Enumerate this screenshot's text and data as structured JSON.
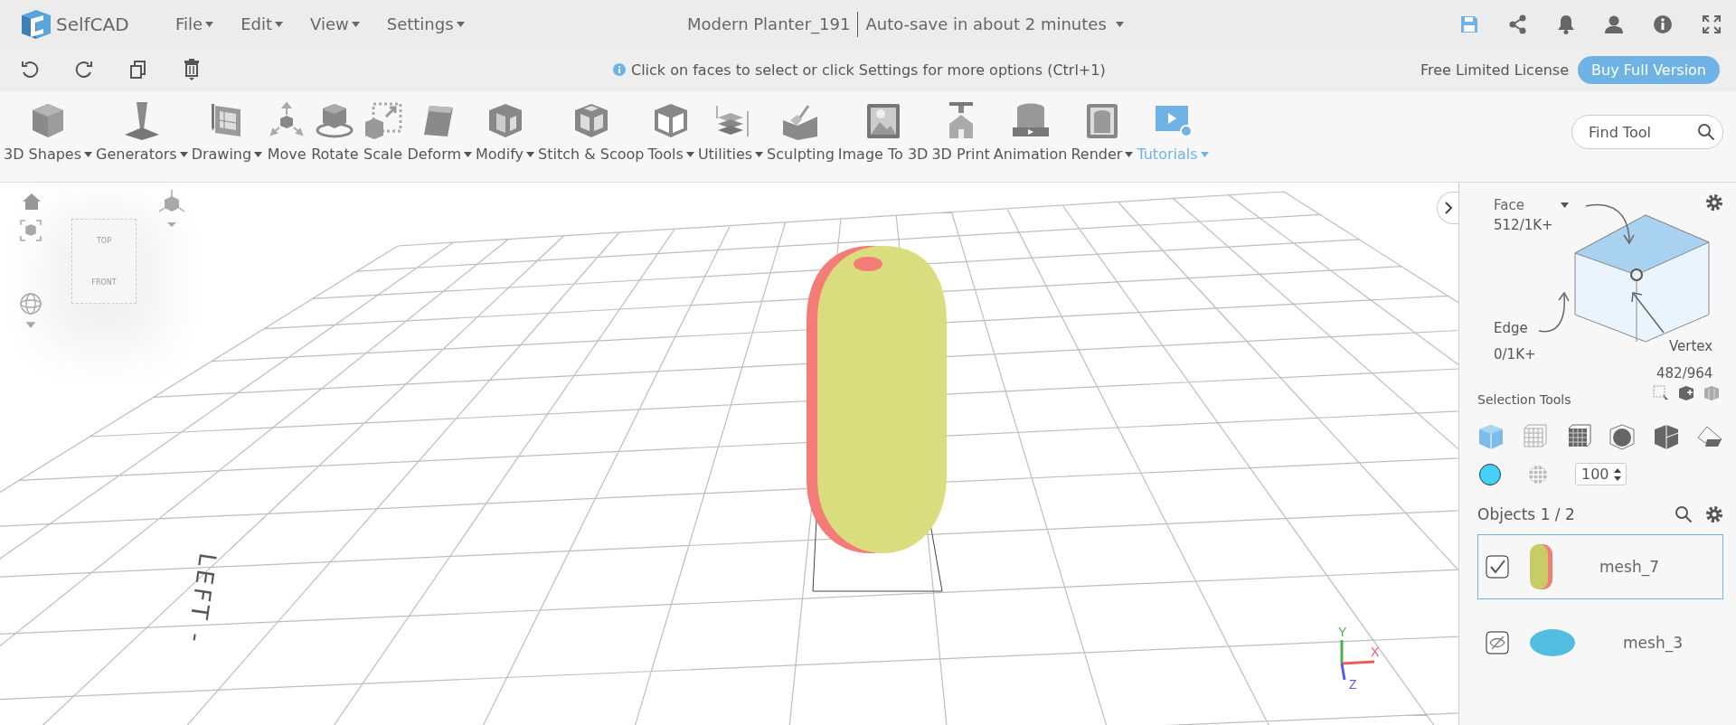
{
  "app": {
    "logo_text": "SelfCAD"
  },
  "menu": [
    "File",
    "Edit",
    "View",
    "Settings"
  ],
  "document": {
    "title": "Modern Planter_191",
    "autosave": "Auto-save in about 2 minutes"
  },
  "hint": "Click on faces to select or click Settings for more options (Ctrl+1)",
  "license": "Free Limited License",
  "buy_button": "Buy Full Version",
  "tools": [
    {
      "label": "3D Shapes",
      "dropdown": true,
      "highlighted": false
    },
    {
      "label": "Generators",
      "dropdown": true,
      "highlighted": false
    },
    {
      "label": "Drawing",
      "dropdown": true,
      "highlighted": false
    },
    {
      "label": "Move",
      "dropdown": false,
      "highlighted": false
    },
    {
      "label": "Rotate",
      "dropdown": false,
      "highlighted": false
    },
    {
      "label": "Scale",
      "dropdown": false,
      "highlighted": false
    },
    {
      "label": "Deform",
      "dropdown": true,
      "highlighted": false
    },
    {
      "label": "Modify",
      "dropdown": true,
      "highlighted": false
    },
    {
      "label": "Stitch & Scoop",
      "dropdown": false,
      "highlighted": false
    },
    {
      "label": "Tools",
      "dropdown": true,
      "highlighted": false
    },
    {
      "label": "Utilities",
      "dropdown": true,
      "highlighted": false
    },
    {
      "label": "Sculpting",
      "dropdown": false,
      "highlighted": false
    },
    {
      "label": "Image To 3D",
      "dropdown": false,
      "highlighted": false
    },
    {
      "label": "3D Print",
      "dropdown": false,
      "highlighted": false
    },
    {
      "label": "Animation",
      "dropdown": false,
      "highlighted": false
    },
    {
      "label": "Render",
      "dropdown": true,
      "highlighted": false
    },
    {
      "label": "Tutorials",
      "dropdown": true,
      "highlighted": true
    }
  ],
  "find_tool": {
    "placeholder": "Find Tool"
  },
  "viewport": {
    "cube_top": "TOP",
    "cube_front": "FRONT",
    "side_label": "LEFT -",
    "axis_x": "X",
    "axis_y": "Y",
    "axis_z": "Z"
  },
  "panel": {
    "face_label": "Face",
    "face_count": "512/1K+",
    "edge_label": "Edge",
    "edge_count": "0/1K+",
    "vertex_label": "Vertex",
    "vertex_count": "482/964",
    "selection_tools": "Selection Tools",
    "opacity": "100",
    "objects_label": "Objects 1 / 2",
    "objects": [
      {
        "name": "mesh_7",
        "selected": true,
        "visible": true
      },
      {
        "name": "mesh_3",
        "selected": false,
        "visible": false
      }
    ]
  }
}
